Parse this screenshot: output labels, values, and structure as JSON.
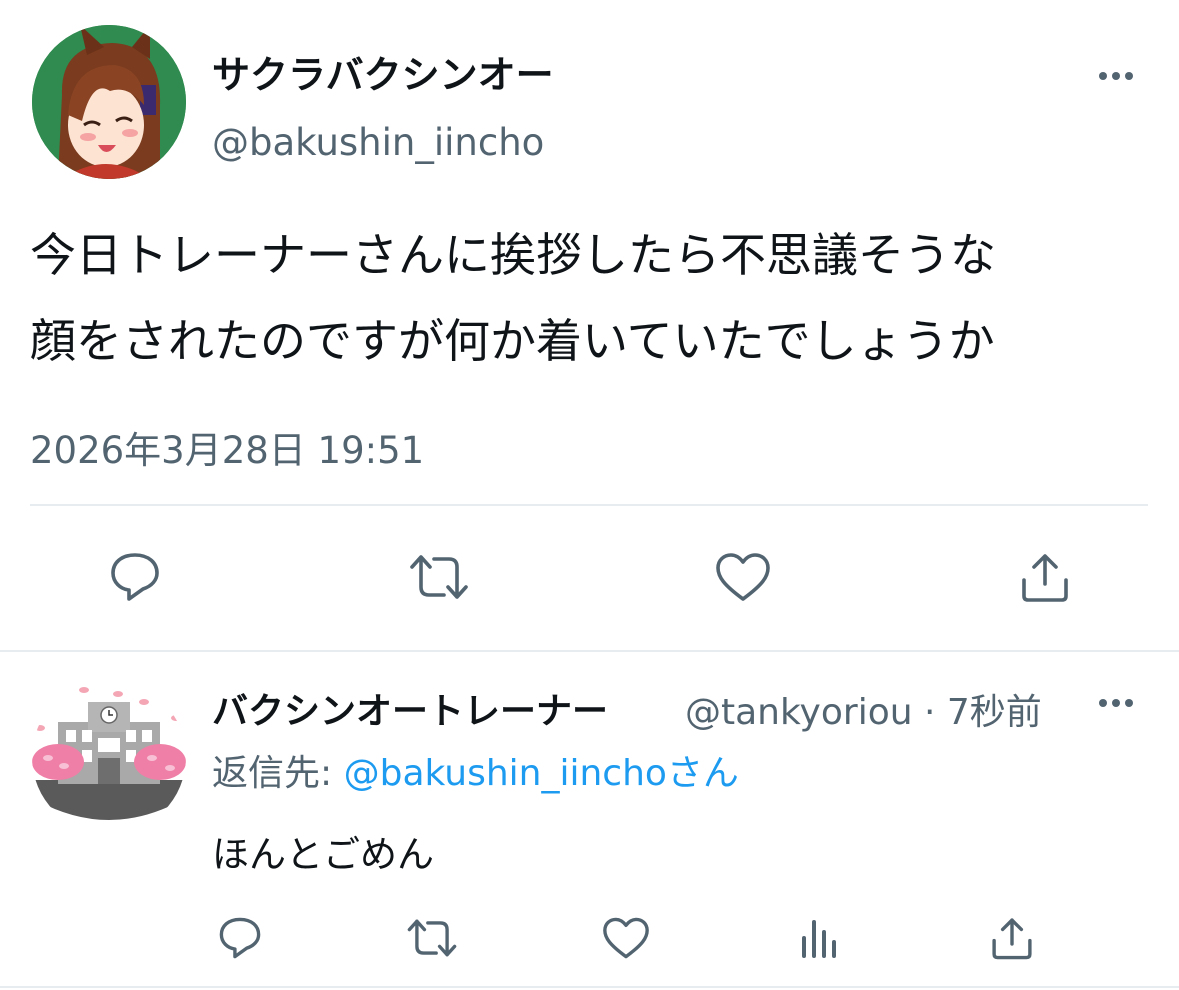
{
  "main_tweet": {
    "display_name": "サクラバクシンオー",
    "handle": "@bakushin_iincho",
    "text": "今日トレーナーさんに挨拶したら不思議そうな\n顔をされたのですが何か着いていたでしょうか",
    "timestamp": "2026年3月28日 19:51",
    "actions": [
      "reply-icon",
      "retweet-icon",
      "like-icon",
      "share-icon"
    ]
  },
  "reply_tweet": {
    "display_name": "バクシンオートレーナー",
    "handle": "@tankyoriou",
    "separator": "·",
    "time_ago": "7秒前",
    "replying_to_label": "返信先:",
    "replying_to_handle": "@bakushin_iincho",
    "replying_to_suffix": "さん",
    "text": "ほんとごめん",
    "actions": [
      "reply-icon",
      "retweet-icon",
      "like-icon",
      "analytics-icon",
      "share-icon"
    ]
  },
  "colors": {
    "text_primary": "#0f1419",
    "text_secondary": "#536471",
    "link": "#1d9bf0",
    "divider": "#e6ecf0"
  }
}
